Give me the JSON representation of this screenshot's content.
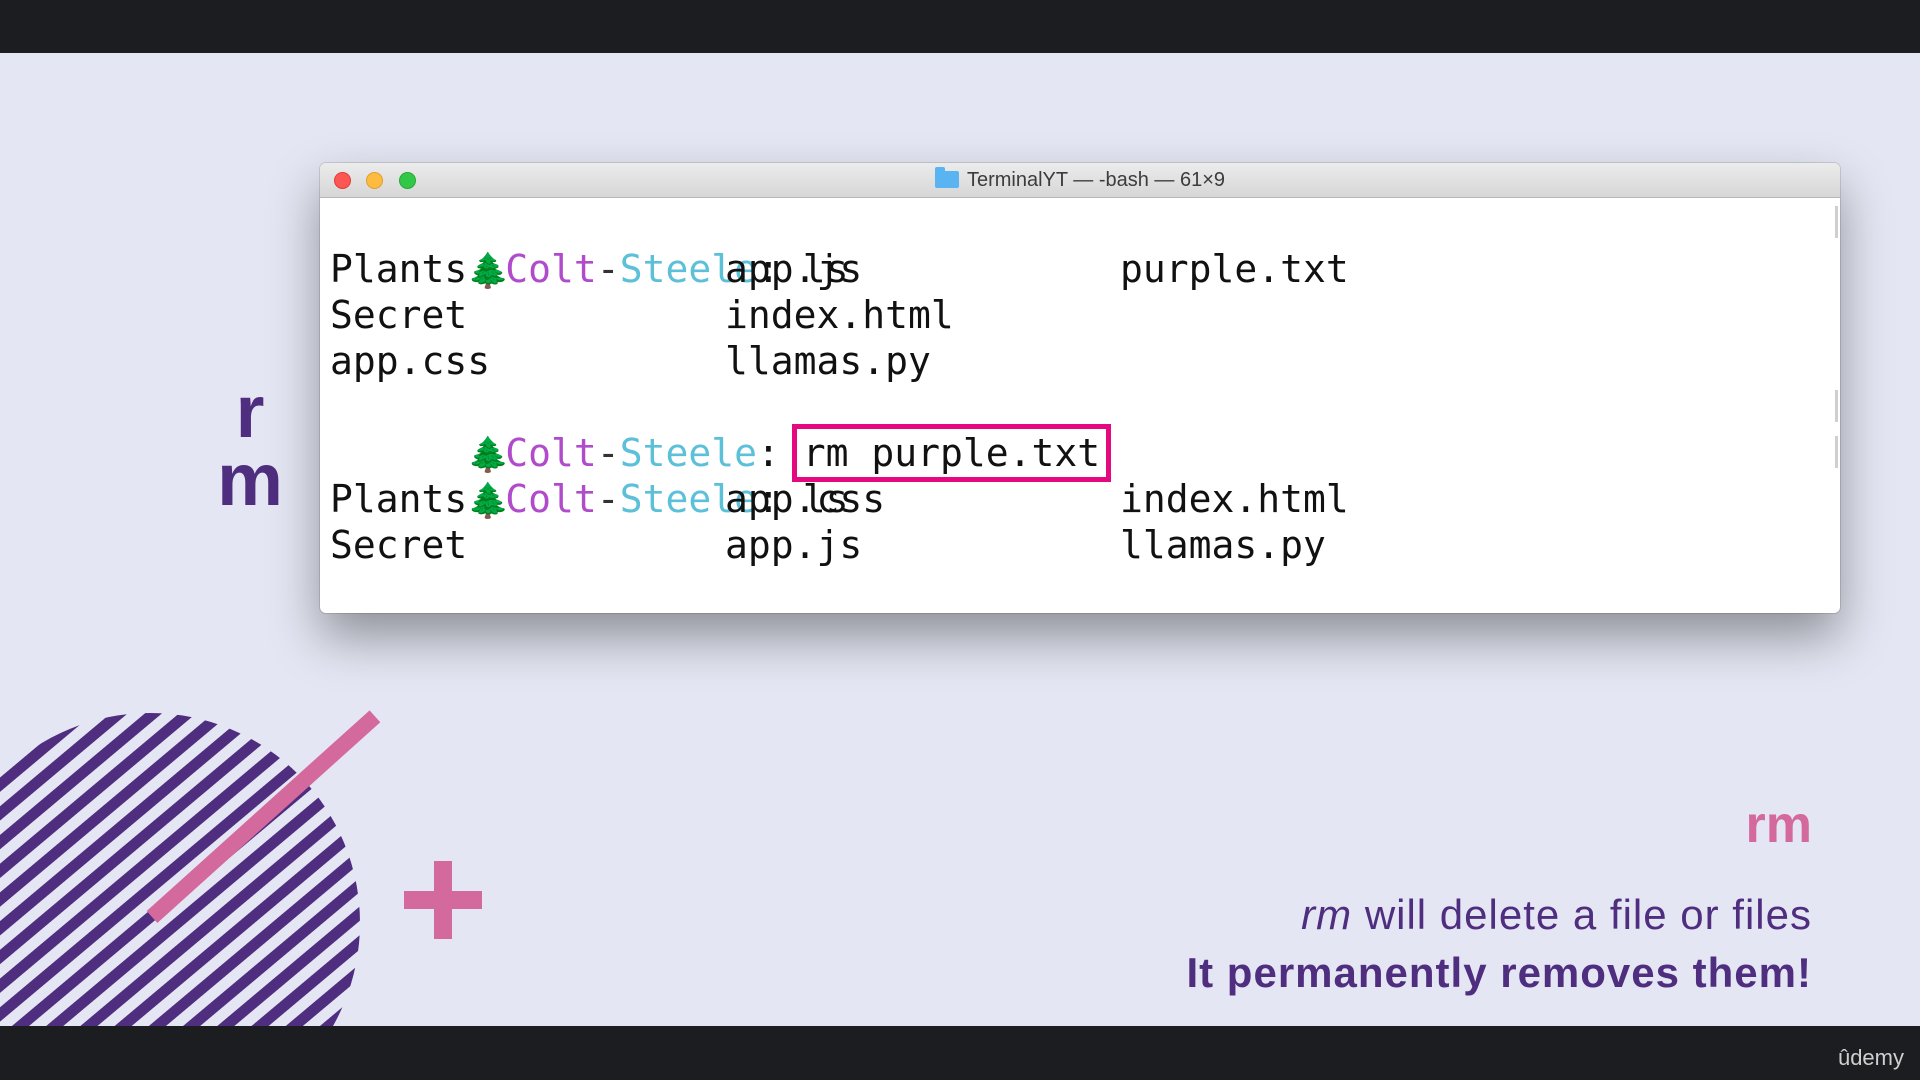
{
  "slide": {
    "side_title_top": "r",
    "side_title_bottom": "m",
    "caption_title": "rm",
    "caption_line1_cmd": "rm",
    "caption_line1_rest": "will delete a file or files",
    "caption_line2": "It permanently removes them!",
    "brand": "ûdemy"
  },
  "terminal": {
    "title": "TerminalYT — -bash — 61×9",
    "prompt_icon": "🌲",
    "prompt_user_part1": "Colt",
    "prompt_dash": "-",
    "prompt_user_part2": "Steele",
    "prompt_colon": ":",
    "cmd1": "ls",
    "listing1": [
      [
        "Plants",
        "app.js",
        "purple.txt"
      ],
      [
        "Secret",
        "index.html",
        ""
      ],
      [
        "app.css",
        "llamas.py",
        ""
      ]
    ],
    "cmd2": "rm purple.txt",
    "cmd3": "ls",
    "listing2": [
      [
        "Plants",
        "app.css",
        "index.html"
      ],
      [
        "Secret",
        "app.js",
        "llamas.py"
      ]
    ]
  },
  "colors": {
    "accent_purple": "#4f2d7f",
    "accent_pink": "#d4699e",
    "highlight_box": "#e5097f",
    "background": "#e4e7f3"
  }
}
